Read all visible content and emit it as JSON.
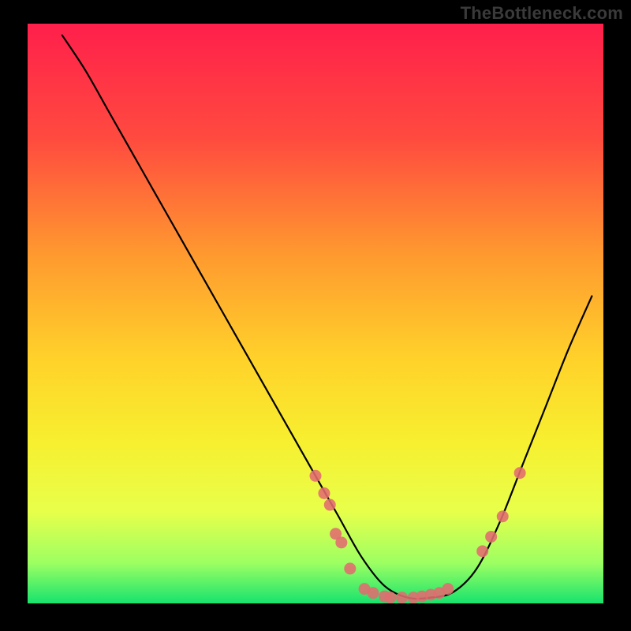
{
  "watermark": "TheBottleneck.com",
  "gradient": {
    "stops": [
      {
        "offset": 0.0,
        "color": "#ff1f4b"
      },
      {
        "offset": 0.2,
        "color": "#ff4b3f"
      },
      {
        "offset": 0.4,
        "color": "#ff9a2f"
      },
      {
        "offset": 0.58,
        "color": "#ffd22a"
      },
      {
        "offset": 0.72,
        "color": "#f7ef2f"
      },
      {
        "offset": 0.84,
        "color": "#e8ff4a"
      },
      {
        "offset": 0.93,
        "color": "#9dff62"
      },
      {
        "offset": 1.0,
        "color": "#17e36d"
      }
    ]
  },
  "chart_data": {
    "type": "line",
    "title": "",
    "xlabel": "",
    "ylabel": "",
    "xlim": [
      0,
      100
    ],
    "ylim": [
      0,
      100
    ],
    "grid": false,
    "legend": false,
    "series": [
      {
        "name": "bottleneck-curve",
        "x": [
          6,
          10,
          14,
          18,
          22,
          26,
          30,
          34,
          38,
          42,
          46,
          50,
          54,
          58,
          62,
          66,
          70,
          74,
          78,
          82,
          86,
          90,
          94,
          98
        ],
        "values": [
          98,
          92,
          85,
          78,
          71,
          64,
          57,
          50,
          43,
          36,
          29,
          22,
          15,
          8,
          3,
          1,
          1,
          2,
          6,
          14,
          24,
          34,
          44,
          53
        ]
      }
    ],
    "markers": {
      "name": "highlighted-points",
      "color": "#e26b6f",
      "points": [
        {
          "x": 50.0,
          "y": 22.0
        },
        {
          "x": 51.5,
          "y": 19.0
        },
        {
          "x": 52.5,
          "y": 17.0
        },
        {
          "x": 53.5,
          "y": 12.0
        },
        {
          "x": 54.5,
          "y": 10.5
        },
        {
          "x": 56.0,
          "y": 6.0
        },
        {
          "x": 58.5,
          "y": 2.5
        },
        {
          "x": 60.0,
          "y": 1.8
        },
        {
          "x": 62.0,
          "y": 1.2
        },
        {
          "x": 63.0,
          "y": 1.0
        },
        {
          "x": 65.0,
          "y": 1.0
        },
        {
          "x": 67.0,
          "y": 1.0
        },
        {
          "x": 68.5,
          "y": 1.2
        },
        {
          "x": 70.0,
          "y": 1.5
        },
        {
          "x": 71.5,
          "y": 1.8
        },
        {
          "x": 73.0,
          "y": 2.5
        },
        {
          "x": 79.0,
          "y": 9.0
        },
        {
          "x": 80.5,
          "y": 11.5
        },
        {
          "x": 82.5,
          "y": 15.0
        },
        {
          "x": 85.5,
          "y": 22.5
        }
      ]
    }
  }
}
